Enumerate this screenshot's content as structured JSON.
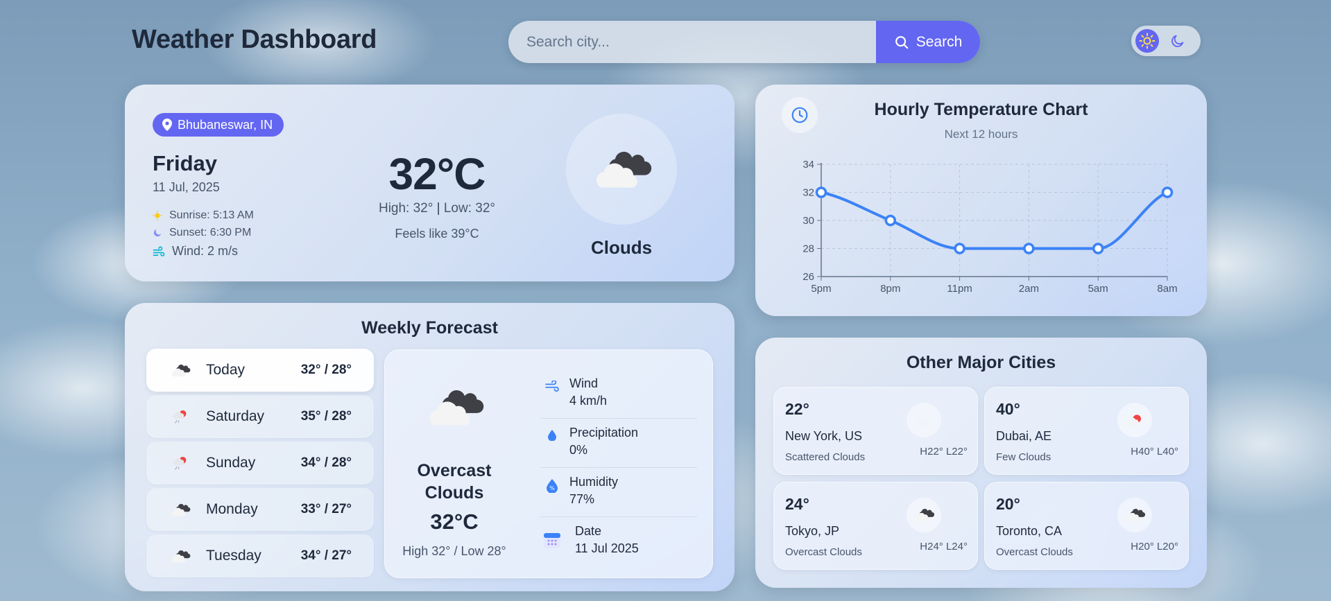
{
  "header": {
    "title": "Weather Dashboard",
    "search_placeholder": "Search city...",
    "search_button": "Search",
    "theme_icons": [
      "sun-icon",
      "moon-icon"
    ],
    "theme_active": "light"
  },
  "current": {
    "location": "Bhubaneswar, IN",
    "day": "Friday",
    "date": "11 Jul, 2025",
    "sunrise": "Sunrise: 5:13 AM",
    "sunset": "Sunset: 6:30 PM",
    "wind": "Wind: 2 m/s",
    "temperature": "32°C",
    "high": "High: 32°",
    "low": "Low: 32°",
    "feels_like": "Feels like 39°C",
    "condition": "Clouds",
    "icon": "cloud-icon"
  },
  "hourly": {
    "title": "Hourly Temperature Chart",
    "subtitle": "Next 12 hours"
  },
  "chart_data": {
    "type": "line",
    "title": "Hourly Temperature Chart",
    "subtitle": "Next 12 hours",
    "categories": [
      "5pm",
      "8pm",
      "11pm",
      "2am",
      "5am",
      "8am"
    ],
    "values": [
      32,
      30,
      28,
      28,
      28,
      32
    ],
    "ylim": [
      26,
      34
    ],
    "yticks": [
      26,
      28,
      30,
      32,
      34
    ],
    "grid": true,
    "line_color": "#3b82f6"
  },
  "weekly": {
    "title": "Weekly Forecast",
    "days": [
      {
        "name": "Today",
        "temps": "32° / 28°",
        "icon": "cloud-icon"
      },
      {
        "name": "Saturday",
        "temps": "35° / 28°",
        "icon": "rain-icon"
      },
      {
        "name": "Sunday",
        "temps": "34° / 28°",
        "icon": "rain-icon"
      },
      {
        "name": "Monday",
        "temps": "33° / 27°",
        "icon": "cloud-icon"
      },
      {
        "name": "Tuesday",
        "temps": "34° / 27°",
        "icon": "cloud-icon"
      }
    ],
    "detail": {
      "condition_line1": "Overcast",
      "condition_line2": "Clouds",
      "temperature": "32°C",
      "hilo": "High 32° / Low 28°",
      "wind_label": "Wind",
      "wind_value": "4 km/h",
      "precip_label": "Precipitation",
      "precip_value": "0%",
      "humidity_label": "Humidity",
      "humidity_value": "77%",
      "date_label": "Date",
      "date_value": "11 Jul 2025"
    }
  },
  "cities": {
    "title": "Other Major Cities",
    "items": [
      {
        "temp": "22°",
        "name": "New York, US",
        "condition": "Scattered Clouds",
        "hl": "H22° L22°",
        "icon": "cloud-icon"
      },
      {
        "temp": "40°",
        "name": "Dubai, AE",
        "condition": "Few Clouds",
        "hl": "H40° L40°",
        "icon": "sun-cloud-icon"
      },
      {
        "temp": "24°",
        "name": "Tokyo, JP",
        "condition": "Overcast Clouds",
        "hl": "H24° L24°",
        "icon": "cloud-icon"
      },
      {
        "temp": "20°",
        "name": "Toronto, CA",
        "condition": "Overcast Clouds",
        "hl": "H20° L20°",
        "icon": "cloud-icon"
      }
    ]
  },
  "colors": {
    "accent": "#6366f1",
    "chart_line": "#3b82f6",
    "text_dark": "#1e293b"
  }
}
